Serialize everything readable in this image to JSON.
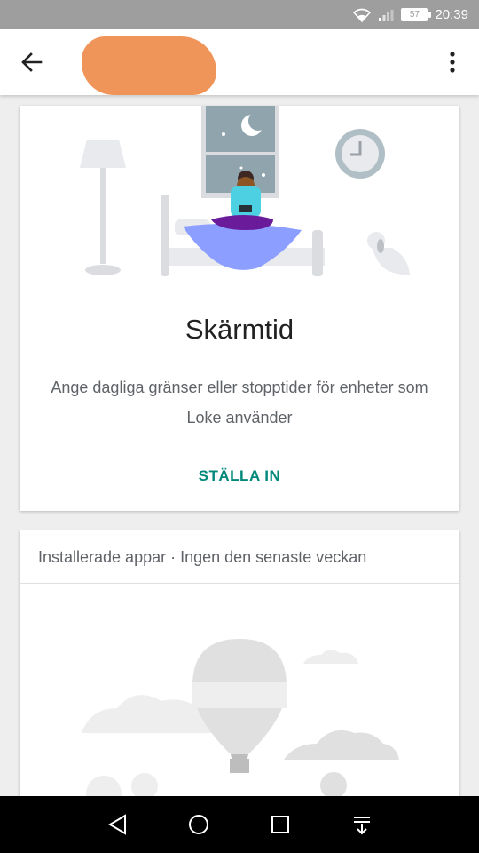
{
  "status_bar": {
    "time": "20:39",
    "battery": "57",
    "icons": [
      "wifi-icon",
      "signal-icon",
      "battery-icon"
    ]
  },
  "app_bar": {
    "title": "",
    "back_icon": "arrow-left-icon",
    "menu_icon": "more-vert-icon"
  },
  "screen_time_card": {
    "title": "Skärmtid",
    "description": "Ange dagliga gränser eller stopptider för enheter som Loke använder",
    "action": "STÄLLA IN"
  },
  "apps_card": {
    "header": "Installerade appar · Ingen den senaste veckan"
  },
  "nav_bar": {
    "buttons": [
      "back-triangle-icon",
      "home-circle-icon",
      "recents-square-icon",
      "notification-pull-icon"
    ]
  },
  "colors": {
    "accent": "#00897b",
    "status_bar": "#9e9e9e",
    "redaction": "#f0955a"
  }
}
